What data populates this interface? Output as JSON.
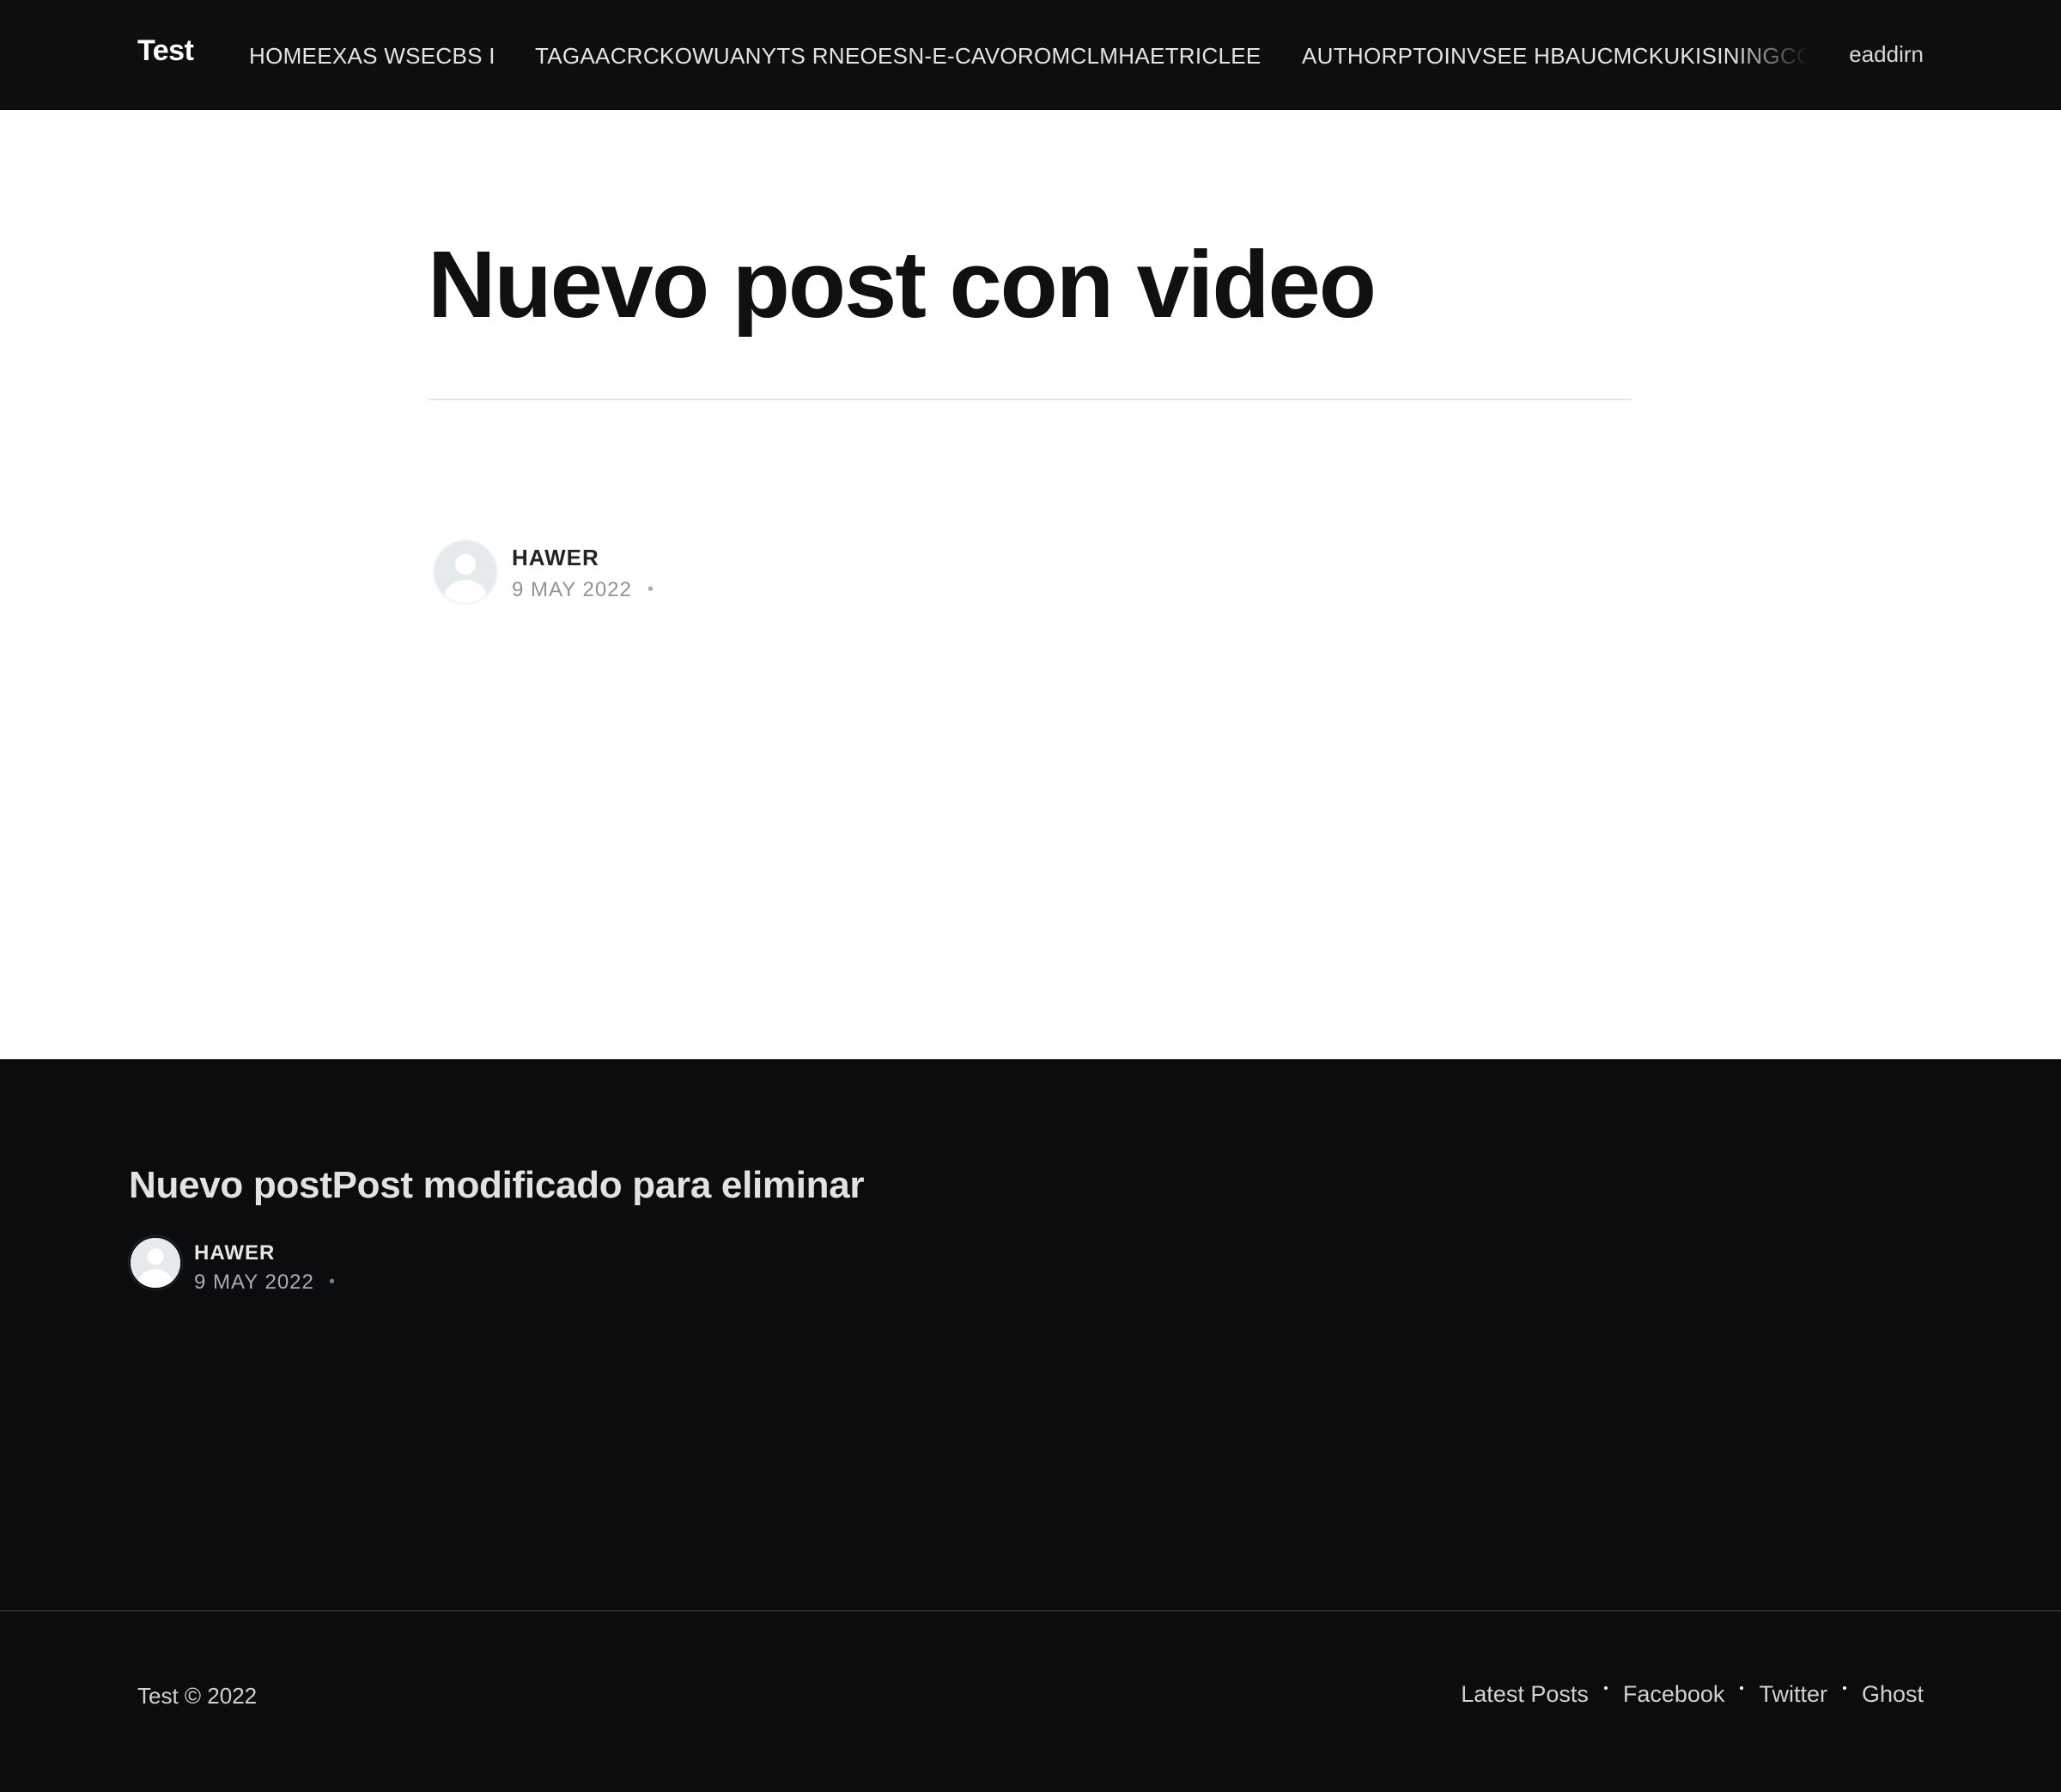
{
  "header": {
    "site_title": "Test",
    "nav": [
      {
        "label": "HOMEEXAS WSECBS I"
      },
      {
        "label": "TAGAACRCKOWUANYTS RNEOESN-E-CAVOROMCLMHAETRICLEE"
      },
      {
        "label": "AUTHORPTOINVSEE HBAUCMCKUKISININGCC"
      }
    ],
    "extra_link": "eaddirn"
  },
  "post": {
    "title": "Nuevo post con video",
    "author": "HAWER",
    "date": "9 MAY 2022",
    "separator": "•"
  },
  "related": {
    "title": "Nuevo postPost modificado para eliminar",
    "author": "HAWER",
    "date": "9 MAY 2022",
    "separator": "•"
  },
  "footer": {
    "copyright": "Test © 2022",
    "links": [
      {
        "label": "Latest Posts"
      },
      {
        "label": "Facebook"
      },
      {
        "label": "Twitter"
      },
      {
        "label": "Ghost"
      }
    ]
  },
  "icons": {
    "author_avatar": "user-avatar-icon"
  },
  "colors": {
    "header_bg": "#0e0e0e",
    "footer_bg": "#0b0c0e",
    "title_text": "#101010",
    "muted_text": "#8d959b"
  }
}
